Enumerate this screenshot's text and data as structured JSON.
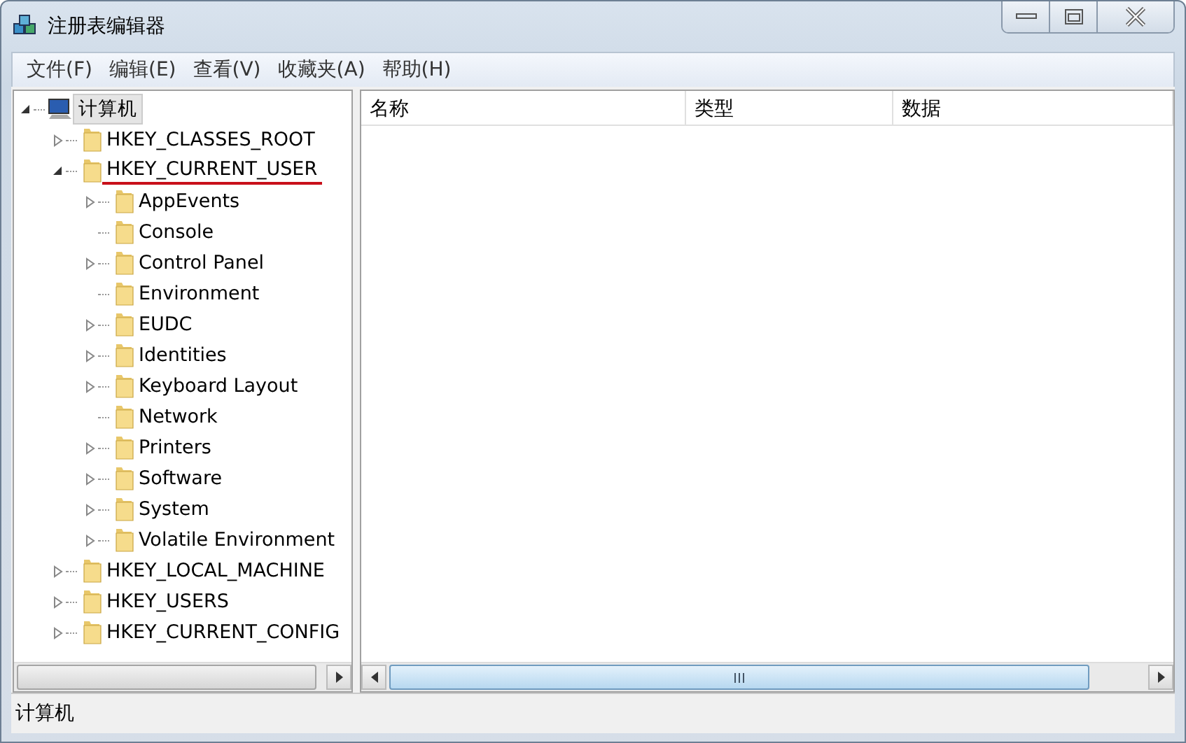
{
  "window": {
    "title": "注册表编辑器"
  },
  "menu": [
    "文件(F)",
    "编辑(E)",
    "查看(V)",
    "收藏夹(A)",
    "帮助(H)"
  ],
  "tree": [
    {
      "label": "计算机",
      "kind": "computer",
      "leaf": false,
      "expanded": true,
      "selected": true,
      "underlined": false,
      "children": [
        {
          "label": "HKEY_CLASSES_ROOT",
          "kind": "folder",
          "leaf": false,
          "expanded": false,
          "selected": false,
          "underlined": false
        },
        {
          "label": "HKEY_CURRENT_USER",
          "kind": "folder",
          "leaf": false,
          "expanded": true,
          "selected": false,
          "underlined": true,
          "children": [
            {
              "label": "AppEvents",
              "kind": "folder",
              "leaf": false,
              "expanded": false,
              "selected": false,
              "underlined": false
            },
            {
              "label": "Console",
              "kind": "folder",
              "leaf": true,
              "expanded": false,
              "selected": false,
              "underlined": false
            },
            {
              "label": "Control Panel",
              "kind": "folder",
              "leaf": false,
              "expanded": false,
              "selected": false,
              "underlined": false
            },
            {
              "label": "Environment",
              "kind": "folder",
              "leaf": true,
              "expanded": false,
              "selected": false,
              "underlined": false
            },
            {
              "label": "EUDC",
              "kind": "folder",
              "leaf": false,
              "expanded": false,
              "selected": false,
              "underlined": false
            },
            {
              "label": "Identities",
              "kind": "folder",
              "leaf": false,
              "expanded": false,
              "selected": false,
              "underlined": false
            },
            {
              "label": "Keyboard Layout",
              "kind": "folder",
              "leaf": false,
              "expanded": false,
              "selected": false,
              "underlined": false
            },
            {
              "label": "Network",
              "kind": "folder",
              "leaf": true,
              "expanded": false,
              "selected": false,
              "underlined": false
            },
            {
              "label": "Printers",
              "kind": "folder",
              "leaf": false,
              "expanded": false,
              "selected": false,
              "underlined": false
            },
            {
              "label": "Software",
              "kind": "folder",
              "leaf": false,
              "expanded": false,
              "selected": false,
              "underlined": false
            },
            {
              "label": "System",
              "kind": "folder",
              "leaf": false,
              "expanded": false,
              "selected": false,
              "underlined": false
            },
            {
              "label": "Volatile Environment",
              "kind": "folder",
              "leaf": false,
              "expanded": false,
              "selected": false,
              "underlined": false
            }
          ]
        },
        {
          "label": "HKEY_LOCAL_MACHINE",
          "kind": "folder",
          "leaf": false,
          "expanded": false,
          "selected": false,
          "underlined": false
        },
        {
          "label": "HKEY_USERS",
          "kind": "folder",
          "leaf": false,
          "expanded": false,
          "selected": false,
          "underlined": false
        },
        {
          "label": "HKEY_CURRENT_CONFIG",
          "kind": "folder",
          "leaf": false,
          "expanded": false,
          "selected": false,
          "underlined": false
        }
      ]
    }
  ],
  "table": {
    "columns": [
      "名称",
      "类型",
      "数据"
    ]
  },
  "status_bar": "计算机"
}
